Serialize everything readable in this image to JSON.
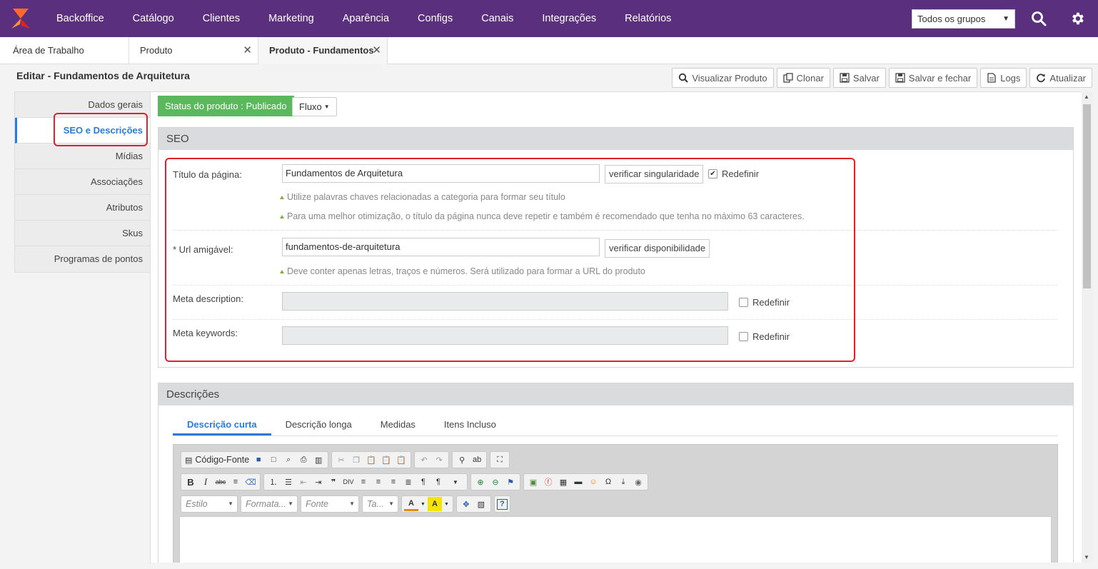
{
  "nav": {
    "items": [
      "Backoffice",
      "Catálogo",
      "Clientes",
      "Marketing",
      "Aparência",
      "Configs",
      "Canais",
      "Integrações",
      "Relatórios"
    ],
    "group_select": "Todos os grupos",
    "brand_color": "#5a2f7e"
  },
  "tabs": [
    {
      "label": "Área de Trabalho"
    },
    {
      "label": "Produto",
      "close": "✕"
    },
    {
      "label": "Produto - Fundamentos",
      "close": "✕"
    }
  ],
  "header": {
    "title": "Editar - Fundamentos de Arquitetura",
    "actions": [
      "Visualizar Produto",
      "Clonar",
      "Salvar",
      "Salvar e fechar",
      "Logs",
      "Atualizar"
    ]
  },
  "sidebar": {
    "items": [
      "Dados gerais",
      "SEO e Descrições",
      "Mídias",
      "Associações",
      "Atributos",
      "Skus",
      "Programas de pontos"
    ],
    "active": "SEO e Descrições"
  },
  "status": {
    "badge": "Status do produto : Publicado",
    "fluxo": "Fluxo",
    "badge_color": "#5cb85c"
  },
  "seo": {
    "title": "SEO",
    "page_title_label": "Título da página:",
    "page_title_value": "Fundamentos de Arquitetura",
    "verify_unique": "verificar singularidade",
    "redefine": "Redefinir",
    "hint1": "Utilize palavras chaves relacionadas a categoria para formar seu título",
    "hint2": "Para uma melhor otimização, o título da página nunca deve repetir e também é recomendado que tenha no máximo 63 caracteres.",
    "url_label": "* Url amigável:",
    "url_value": "fundamentos-de-arquitetura",
    "verify_available": "verificar disponibilidade",
    "hint3": "Deve conter apenas letras, traços e números. Será utilizado para formar a URL do produto",
    "meta_desc_label": "Meta description:",
    "meta_kw_label": "Meta keywords:"
  },
  "descriptions": {
    "title": "Descrições",
    "tabs": [
      "Descrição curta",
      "Descrição longa",
      "Medidas",
      "Itens Incluso"
    ],
    "active_tab": "Descrição curta",
    "editor": {
      "source": "Código-Fonte",
      "style": "Estilo",
      "format": "Formata...",
      "font": "Fonte",
      "size": "Ta..."
    }
  }
}
